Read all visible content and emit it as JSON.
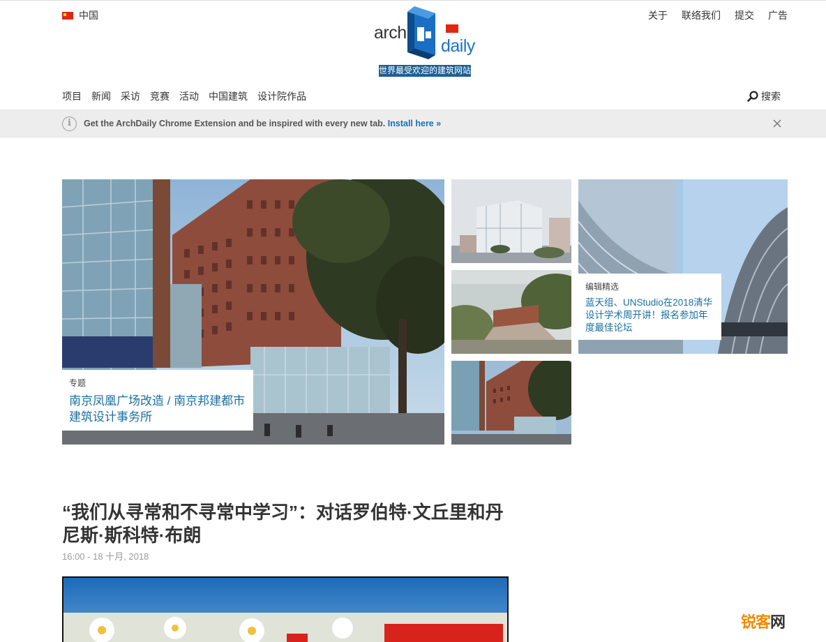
{
  "header": {
    "country": "中国",
    "top_links": [
      "关于",
      "联络我们",
      "提交",
      "广告"
    ],
    "logo_left": "arch",
    "logo_right": "daily",
    "tagline": "世界最受欢迎的建筑网站"
  },
  "nav": {
    "items": [
      "项目",
      "新闻",
      "采访",
      "竞赛",
      "活动",
      "中国建筑",
      "设计院作品"
    ],
    "search_label": "搜索"
  },
  "extension_bar": {
    "text": "Get the ArchDaily Chrome Extension and be inspired with every new tab.",
    "link": "Install here »"
  },
  "hero": {
    "main_caption": {
      "category": "专题",
      "title": "南京凤凰广场改造 / 南京邦建都市建筑设计事务所"
    },
    "side_caption": {
      "category": "编辑精选",
      "title": "蓝天组、UNStudio在2018清华设计学术周开讲！报名参加年度最佳论坛"
    }
  },
  "article": {
    "title": "“我们从寻常和不寻常中学习”：对话罗伯特·文丘里和丹尼斯·斯科特·布朗",
    "date": "16:00 - 18 十月, 2018"
  },
  "watermark": {
    "part1": "锐客",
    "part2": "网"
  },
  "colors": {
    "link": "#1a6f9e",
    "tagline_bg": "#1f5f93",
    "brand_blue": "#1a75c6",
    "flag_red": "#de2910"
  },
  "icons": {
    "info": "info-icon",
    "close": "close-icon",
    "search": "search-icon",
    "flag": "china-flag-icon"
  }
}
